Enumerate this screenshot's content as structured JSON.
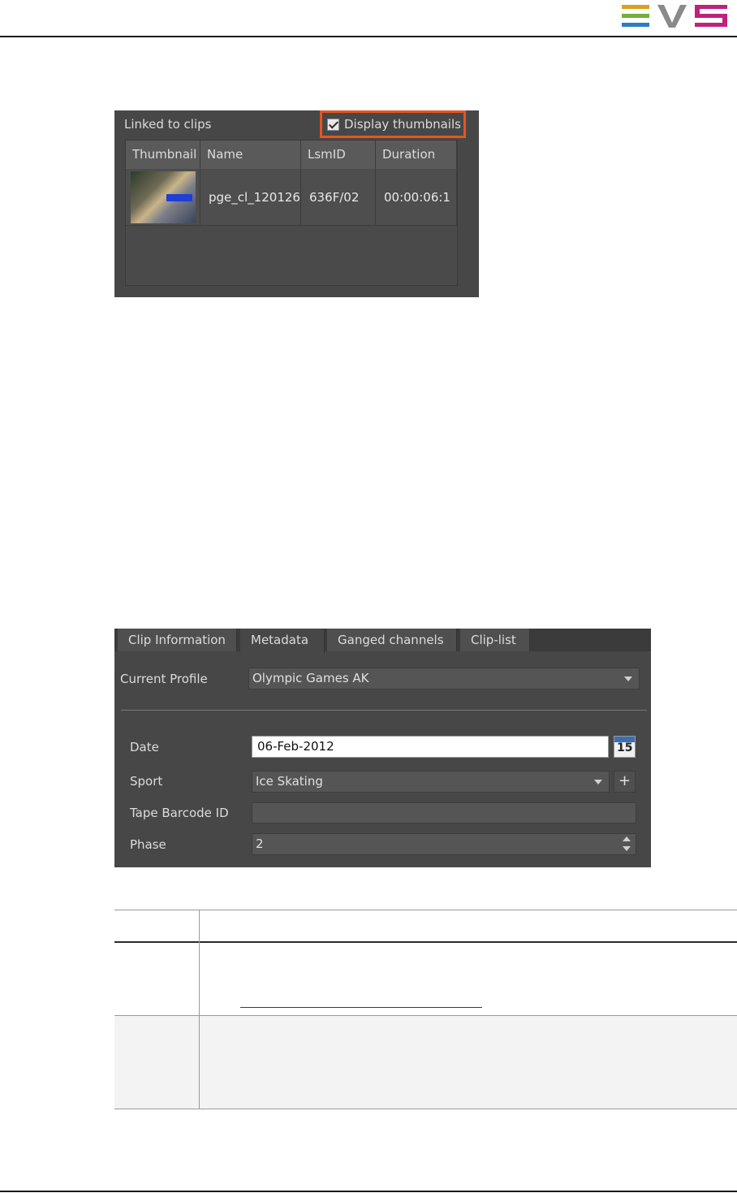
{
  "logo": {
    "text": "EVS",
    "colors": {
      "e": "#2aa7b5",
      "v": "#8a8a8a",
      "s": "#c0217d"
    }
  },
  "linked_clips": {
    "label": "Linked to clips",
    "display_thumbnails_label": "Display thumbnails",
    "display_thumbnails_checked": true,
    "columns": [
      "Thumbnail",
      "Name",
      "LsmID",
      "Duration"
    ],
    "rows": [
      {
        "name": "pge_cl_120126",
        "lsmid": "636F/02",
        "duration": "00:00:06:1"
      }
    ]
  },
  "metadata_panel": {
    "tabs": [
      "Clip Information",
      "Metadata",
      "Ganged channels",
      "Clip-list"
    ],
    "active_tab": "Metadata",
    "current_profile_label": "Current Profile",
    "current_profile_value": "Olympic Games AK",
    "fields": {
      "date_label": "Date",
      "date_value": "06-Feb-2012",
      "calendar_day": "15",
      "sport_label": "Sport",
      "sport_value": "Ice Skating",
      "tape_barcode_label": "Tape Barcode ID",
      "tape_barcode_value": "",
      "phase_label": "Phase",
      "phase_value": "2"
    },
    "add_button": "+"
  },
  "colors": {
    "highlight": "#e8541f"
  }
}
